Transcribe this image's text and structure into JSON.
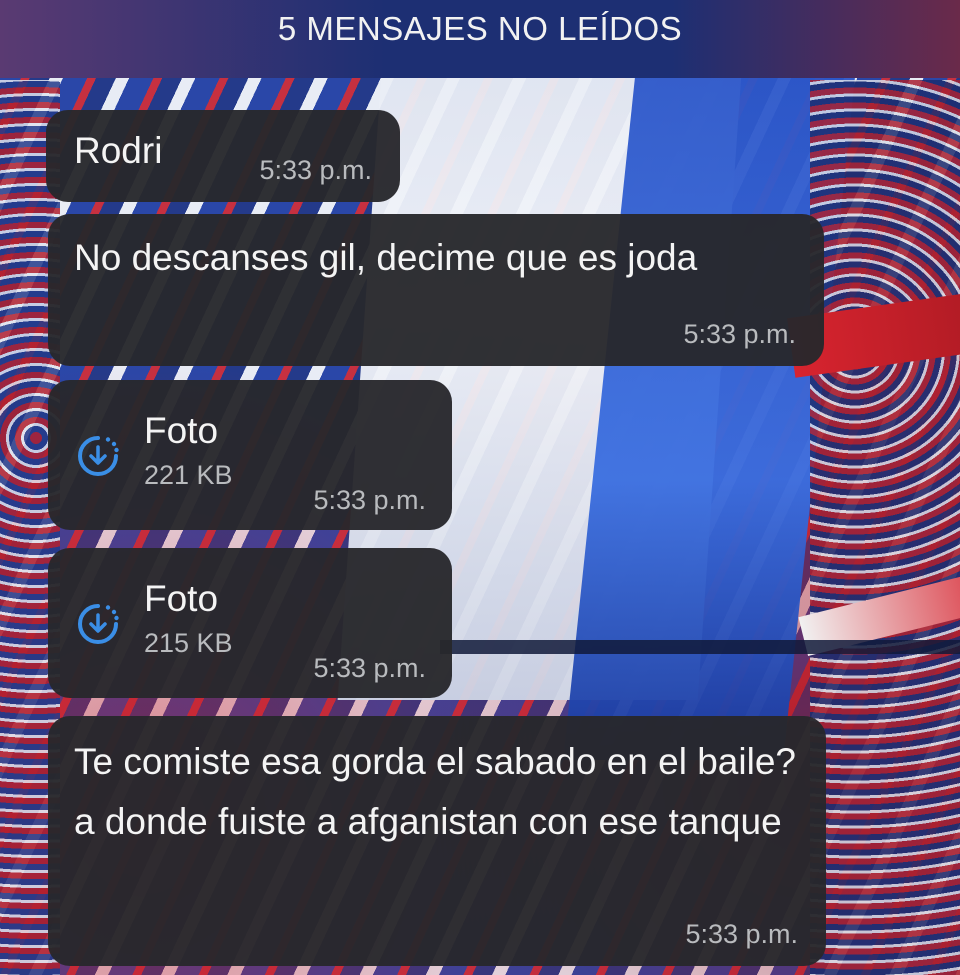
{
  "header": {
    "unread_banner": "5 MENSAJES NO LEÍDOS"
  },
  "messages": [
    {
      "type": "sender",
      "name": "Rodri",
      "time": "5:33 p.m."
    },
    {
      "type": "text",
      "text": "No descanses gil, decime que es joda",
      "time": "5:33 p.m."
    },
    {
      "type": "photo",
      "label": "Foto",
      "size": "221 KB",
      "time": "5:33 p.m.",
      "icon": "download-icon"
    },
    {
      "type": "photo",
      "label": "Foto",
      "size": "215 KB",
      "time": "5:33 p.m.",
      "icon": "download-icon"
    },
    {
      "type": "text",
      "text": "Te comiste esa gorda el sabado en el baile? a donde fuiste a afganistan con ese tanque",
      "time": "5:33 p.m."
    }
  ],
  "colors": {
    "bubble": "#28282c",
    "timestamp": "#b9bbbe",
    "icon_accent": "#3a8ee6"
  }
}
